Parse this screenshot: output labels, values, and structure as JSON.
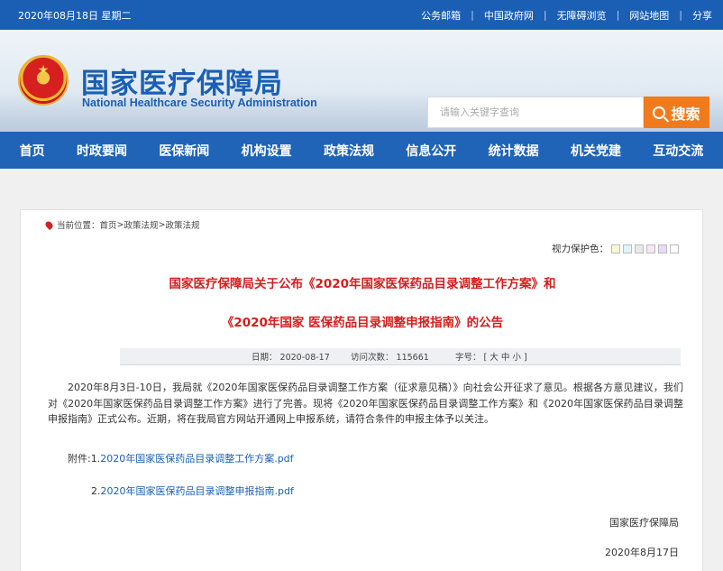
{
  "topbar": {
    "date": "2020年08月18日 星期二",
    "links": [
      "公务邮箱",
      "中国政府网",
      "无障碍浏览",
      "网站地图",
      "分享"
    ]
  },
  "header": {
    "logo_cn": "国家医疗保障局",
    "logo_en": "National Healthcare Security Administration",
    "search_placeholder": "请输入关键字查询",
    "search_button": "搜索"
  },
  "nav": [
    "首页",
    "时政要闻",
    "医保新闻",
    "机构设置",
    "政策法规",
    "信息公开",
    "统计数据",
    "机关党建",
    "互动交流"
  ],
  "breadcrumb": {
    "label": "当前位置：",
    "items": [
      "首页",
      "政策法规",
      "政策法规"
    ],
    "sep": ">"
  },
  "vision": {
    "label": "视力保护色：",
    "colors": [
      "#fafad2",
      "#dff3f8",
      "#e8e8e8",
      "#f9e7f3",
      "#e6dcf5",
      "#ffffff"
    ]
  },
  "article": {
    "title_line1": "国家医疗保障局关于公布《2020年国家医保药品目录调整工作方案》和",
    "title_line2": "《2020年国家 医保药品目录调整申报指南》的公告",
    "meta": {
      "date_label": "日期：",
      "date": "2020-08-17",
      "visits_label": "访问次数：",
      "visits": "115661",
      "size_label": "字号：",
      "size_open": "[",
      "sizes": [
        "大",
        "中",
        "小"
      ],
      "size_close": "]"
    },
    "body": "2020年8月3日-10日，我局就《2020年国家医保药品目录调整工作方案（征求意见稿）》向社会公开征求了意见。根据各方意见建议，我们对《2020年国家医保药品目录调整工作方案》进行了完善。现将《2020年国家医保药品目录调整工作方案》和《2020年国家医保药品目录调整申报指南》正式公布。近期，将在我局官方网站开通网上申报系统，请符合条件的申报主体予以关注。",
    "attach_label": "附件:1.",
    "attach1": "2020年国家医保药品目录调整工作方案.pdf",
    "attach2_num": "2.",
    "attach2": "2020年国家医保药品目录调整申报指南.pdf",
    "signature": "国家医疗保障局",
    "sign_date": "2020年8月17日"
  }
}
